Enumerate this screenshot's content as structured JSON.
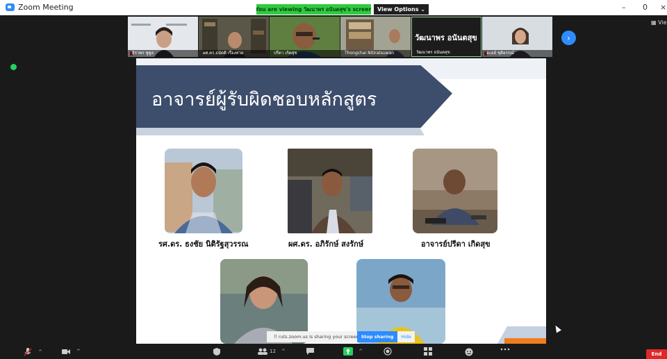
{
  "window": {
    "title": "Zoom Meeting",
    "min": "–",
    "restore": "0",
    "close": "×"
  },
  "share_status": {
    "viewing": "You are viewing วัฒนาพร อนันตสุข's screen",
    "view_options": "View Options ⌄",
    "view_button": "▦ Vie"
  },
  "thumbnails": [
    {
      "name": "ธิราพร ชูพูล",
      "muted": true,
      "bg": "#dde3e8"
    },
    {
      "name": "ผศ.ดร.ธนัตติ เรื่องท่วย",
      "muted": false,
      "bg": "#6b6a55"
    },
    {
      "name": "ปรีดา เกิดสุข",
      "muted": false,
      "bg": "#5a7a3a"
    },
    {
      "name": "Thongchai Nitiratsuwan",
      "muted": false,
      "bg": "#8a8b7c"
    },
    {
      "name": "วัฒนาพร อนันตสุข",
      "big": "วัฒนาพร อนันตสุข",
      "muted": false,
      "bg": "#1c1c1c"
    },
    {
      "name": "ละออ์ ชุติอรรณ์",
      "muted": true,
      "bg": "#cfd6dc"
    }
  ],
  "slide": {
    "title": "อาจารย์ผู้รับผิดชอบหลักสูตร",
    "people": [
      {
        "name": "รศ.ดร. ธงชัย  นิติรัฐสุวรรณ",
        "bg": "#b9c7d6"
      },
      {
        "name": "ผศ.ดร. อภิรักษ์  สงรักษ์",
        "bg": "#6f6a5c"
      },
      {
        "name": "อาจารย์ปรีดา  เกิดสุข",
        "bg": "#8c7a66"
      },
      {
        "name": "",
        "bg": "#6b7f7c"
      },
      {
        "name": "",
        "bg": "#7ca6c8"
      }
    ]
  },
  "share_bar": {
    "text": "⠿ ruts.zoom.us is sharing your screen.",
    "stop": "Stop sharing",
    "hide": "Hide"
  },
  "toolbar": {
    "participants_count": "12",
    "end": "End"
  }
}
